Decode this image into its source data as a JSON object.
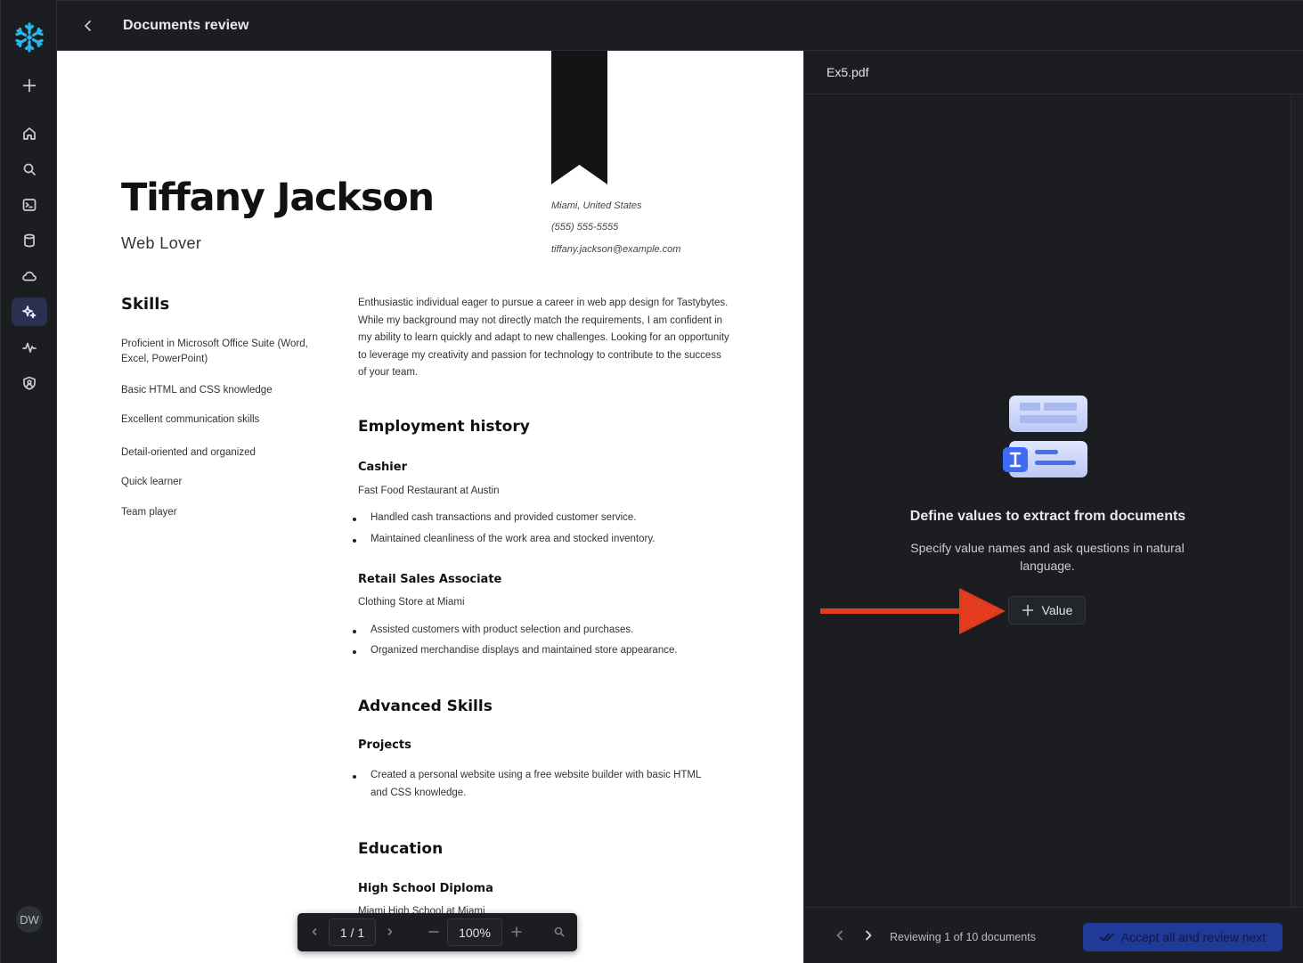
{
  "app": {
    "title": "Documents review",
    "user_initials": "DW",
    "colors": {
      "accent": "#2a3150",
      "primary_button": "#1f3a97",
      "arrow": "#e33b1e",
      "logo": "#29b5e8"
    }
  },
  "sidebar": {
    "items": [
      {
        "name": "add",
        "icon": "plus-icon"
      },
      {
        "name": "home",
        "icon": "home-icon"
      },
      {
        "name": "search",
        "icon": "search-icon"
      },
      {
        "name": "worksheets",
        "icon": "terminal-icon"
      },
      {
        "name": "data",
        "icon": "database-icon"
      },
      {
        "name": "cloud",
        "icon": "cloud-icon"
      },
      {
        "name": "ai",
        "icon": "sparkle-icon",
        "active": true
      },
      {
        "name": "monitoring",
        "icon": "activity-icon"
      },
      {
        "name": "admin",
        "icon": "shield-icon"
      }
    ]
  },
  "document": {
    "name": "Tiffany Jackson",
    "role": "Web Lover",
    "contact": {
      "location": "Miami, United States",
      "phone": "(555) 555-5555",
      "email": "tiffany.jackson@example.com"
    },
    "skills_heading": "Skills",
    "skills": [
      "Proficient in Microsoft Office Suite (Word, Excel, PowerPoint)",
      "Basic HTML and CSS knowledge",
      "Excellent communication skills",
      "Detail-oriented and organized",
      "Quick learner",
      "Team player"
    ],
    "summary": "Enthusiastic individual eager to pursue a career in web app design for Tastybytes. While my background may not directly match the requirements, I am confident in my ability to learn quickly and adapt to new challenges. Looking for an opportunity to leverage my creativity and passion for technology to contribute to the success of your team.",
    "employment_heading": "Employment history",
    "jobs": [
      {
        "title": "Cashier",
        "place": "Fast Food Restaurant at Austin",
        "bullets": [
          "Handled cash transactions and provided customer service.",
          "Maintained cleanliness of the work area and stocked inventory."
        ]
      },
      {
        "title": "Retail Sales Associate",
        "place": "Clothing Store at Miami",
        "bullets": [
          "Assisted customers with product selection and purchases.",
          "Organized merchandise displays and maintained store appearance."
        ]
      }
    ],
    "advanced_heading": "Advanced Skills",
    "projects_heading": "Projects",
    "projects": [
      "Created a personal website using a free website builder with basic HTML and CSS knowledge."
    ],
    "education_heading": "Education",
    "education_title": "High School Diploma",
    "education_place": "Miami High School at Miami"
  },
  "viewer_toolbar": {
    "page": "1 / 1",
    "zoom": "100%"
  },
  "panel": {
    "file_name": "Ex5.pdf",
    "empty_title": "Define values to extract from documents",
    "empty_desc": "Specify value names and ask questions in natural language.",
    "add_value_label": "Value",
    "status": "Reviewing 1 of 10 documents",
    "accept_label": "Accept all and review next"
  }
}
